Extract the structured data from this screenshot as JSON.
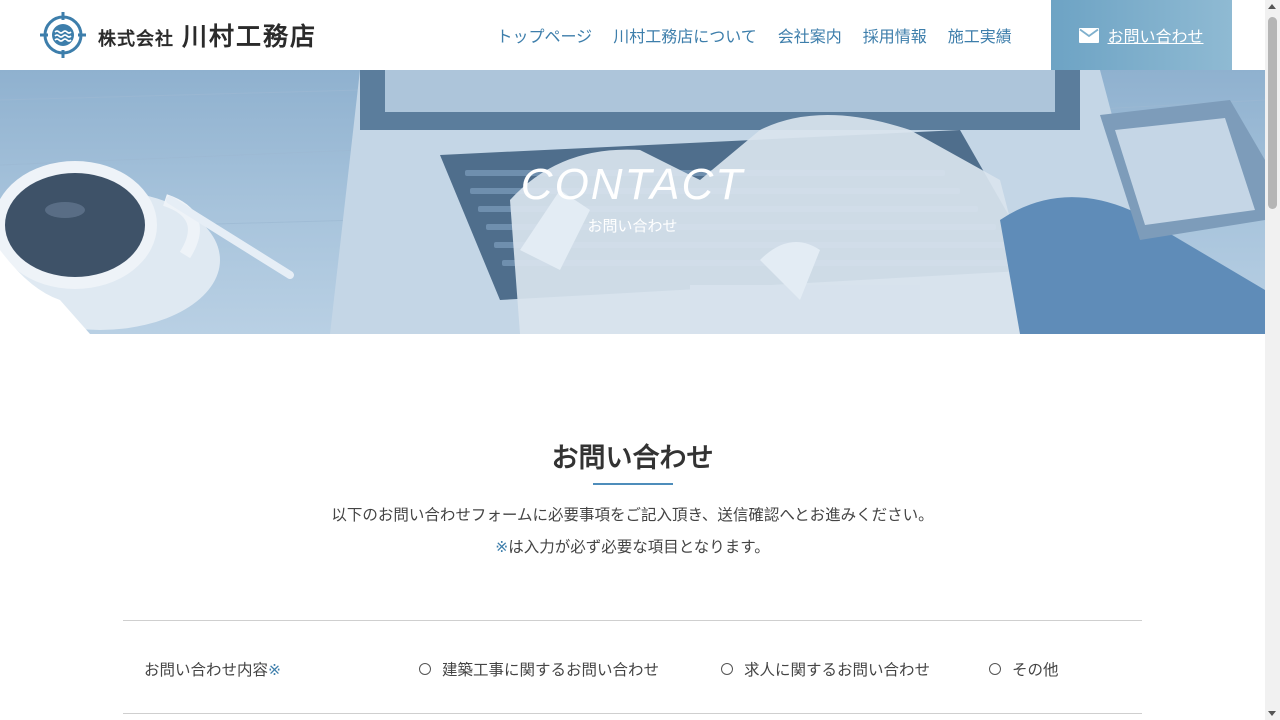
{
  "header": {
    "logo_small": "株式会社",
    "logo_big": "川村工務店",
    "nav": [
      "トップページ",
      "川村工務店について",
      "会社案内",
      "採用情報",
      "施工実績"
    ],
    "contact_label": "お問い合わせ",
    "accent_color": "#3d7eab"
  },
  "hero": {
    "title": "CONTACT",
    "subtitle": "お問い合わせ"
  },
  "main": {
    "title": "お問い合わせ",
    "intro": "以下のお問い合わせフォームに必要事項をご記入頂き、送信確認へとお進みください。",
    "note_mark": "※",
    "note_text": "は入力が必ず必要な項目となります。"
  },
  "form": {
    "inquiry_label": "お問い合わせ内容",
    "required_mark": "※",
    "options": [
      "建築工事に関するお問い合わせ",
      "求人に関するお問い合わせ",
      "その他"
    ]
  }
}
